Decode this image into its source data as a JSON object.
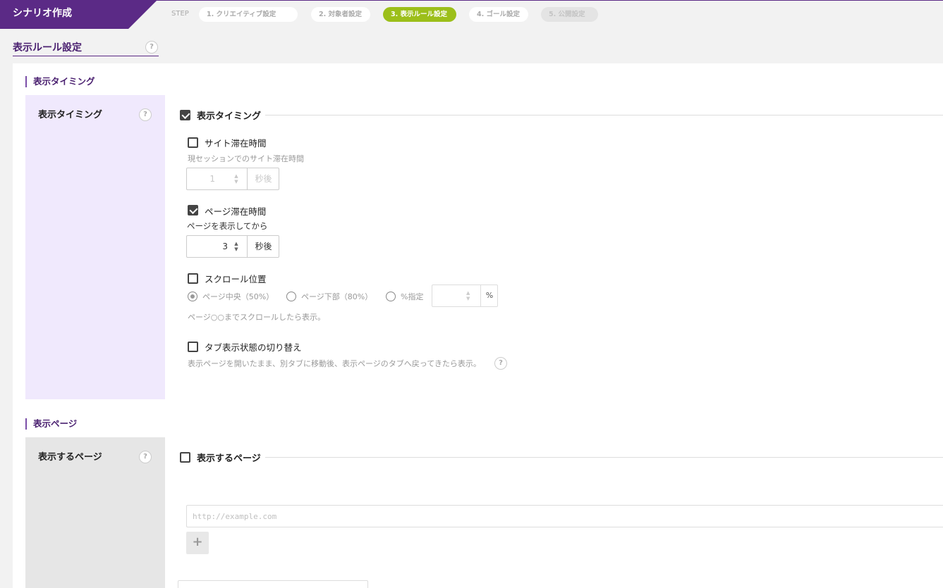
{
  "header": {
    "app_title": "シナリオ作成",
    "step_label": "STEP",
    "steps": [
      {
        "label": "1. クリエイティブ設定",
        "state": "done"
      },
      {
        "label": "2. 対象者設定",
        "state": "done"
      },
      {
        "label": "3. 表示ルール設定",
        "state": "active"
      },
      {
        "label": "4. ゴール設定",
        "state": "done"
      },
      {
        "label": "5. 公開設定",
        "state": "disabled"
      }
    ]
  },
  "page": {
    "title": "表示ルール設定",
    "help_icon": "?"
  },
  "timing_section": {
    "title": "表示タイミング",
    "row_label": "表示タイミング",
    "group_title": "表示タイミング",
    "group_checked": true,
    "site_time": {
      "label": "サイト滞在時間",
      "checked": false,
      "description": "現セッションでのサイト滞在時間",
      "value": "1",
      "unit": "秒後"
    },
    "page_time": {
      "label": "ページ滞在時間",
      "checked": true,
      "description": "ページを表示してから",
      "value": "3",
      "unit": "秒後"
    },
    "scroll": {
      "label": "スクロール位置",
      "checked": false,
      "options": [
        "ページ中央（50%）",
        "ページ下部（80%）",
        "%指定"
      ],
      "selected": "ページ中央（50%）",
      "percent_unit": "%",
      "description": "ページ○○までスクロールしたら表示。"
    },
    "tab_switch": {
      "label": "タブ表示状態の切り替え",
      "checked": false,
      "description": "表示ページを開いたまま、別タブに移動後、表示ページのタブへ戻ってきたら表示。"
    }
  },
  "page_section": {
    "title": "表示ページ",
    "row_label": "表示するページ",
    "group_title": "表示するページ",
    "group_checked": false,
    "url_placeholder": "http://example.com",
    "add_button": "+"
  },
  "colors": {
    "brand": "#5b2a86",
    "active_step": "#9cbf1a",
    "timing_label_bg": "#f0e9fd",
    "page_label_bg": "#e6e6e6"
  }
}
